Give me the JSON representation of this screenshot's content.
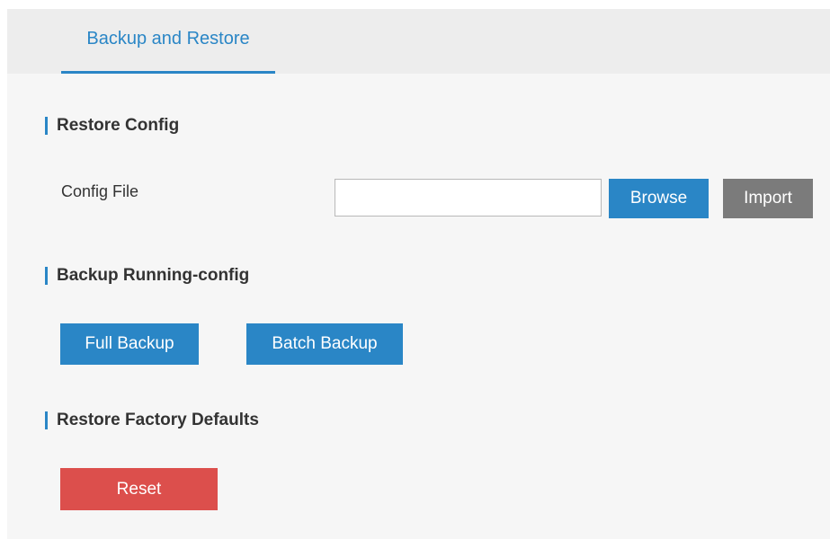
{
  "tabs": [
    {
      "label": "Backup and Restore",
      "active": true
    }
  ],
  "sections": {
    "restore_config": {
      "title": "Restore Config",
      "config_file_label": "Config File",
      "config_file_value": "",
      "browse_label": "Browse",
      "import_label": "Import"
    },
    "backup_running": {
      "title": "Backup Running-config",
      "full_backup_label": "Full Backup",
      "batch_backup_label": "Batch Backup"
    },
    "factory_defaults": {
      "title": "Restore Factory Defaults",
      "reset_label": "Reset"
    }
  },
  "colors": {
    "accent": "#2a86c6",
    "import_button": "#7b7b7b",
    "reset_button": "#dc4f4c",
    "panel_background": "#f6f6f6",
    "tabbar_background": "#ededed"
  }
}
